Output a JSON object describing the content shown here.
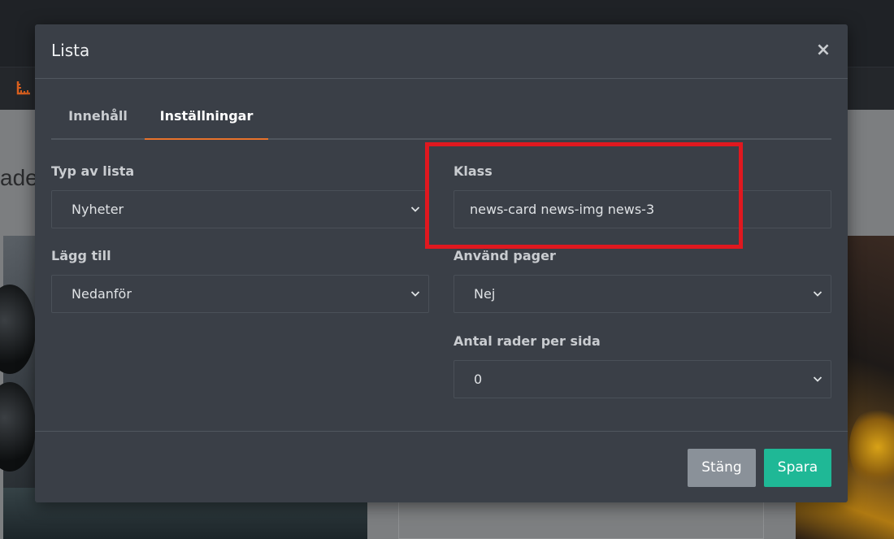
{
  "background": {
    "heading_fragment": "ade"
  },
  "modal": {
    "title": "Lista",
    "close_glyph": "×",
    "tabs": [
      {
        "label": "Innehåll",
        "active": false
      },
      {
        "label": "Inställningar",
        "active": true
      }
    ],
    "fields": {
      "list_type": {
        "label": "Typ av lista",
        "value": "Nyheter"
      },
      "class": {
        "label": "Klass",
        "value": "news-card news-img news-3"
      },
      "add_position": {
        "label": "Lägg till",
        "value": "Nedanför"
      },
      "use_pager": {
        "label": "Använd pager",
        "value": "Nej"
      },
      "rows_per_page": {
        "label": "Antal rader per sida",
        "value": "0"
      }
    },
    "buttons": {
      "close_label": "Stäng",
      "save_label": "Spara"
    }
  },
  "colors": {
    "accent_tab": "#e8722c",
    "save_button": "#1fb896",
    "close_button": "#8a9199",
    "highlight": "#e0181f",
    "modal_bg": "#3a3f47"
  },
  "icons": [
    "ruler-icon",
    "close-icon",
    "chevron-down-icon"
  ]
}
